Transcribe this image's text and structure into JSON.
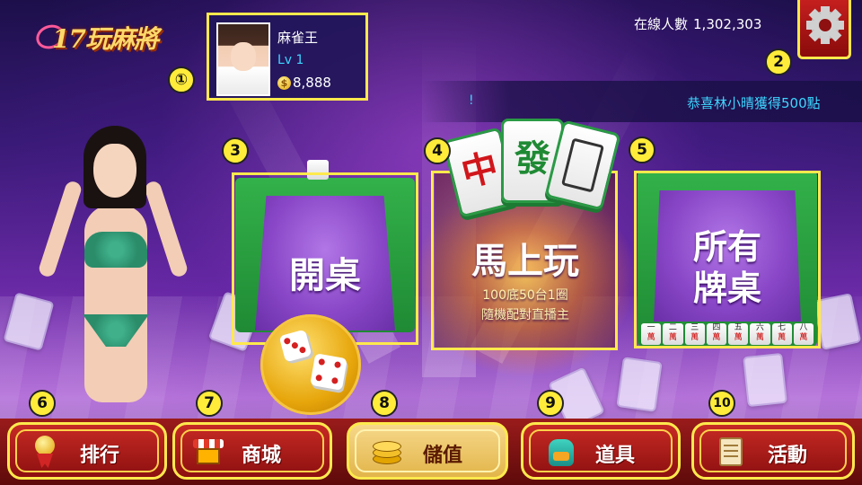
{
  "brand": {
    "logo_text": "17玩麻將"
  },
  "profile": {
    "name": "麻雀王",
    "level": "Lv 1",
    "coin_symbol": "$",
    "coins": "8,888"
  },
  "online": {
    "label": "在線人數",
    "count": "1,302,303"
  },
  "ticker": {
    "left_mark": "!",
    "text": "恭喜林小晴獲得500點"
  },
  "markers": [
    "①",
    "2",
    "3",
    "4",
    "5",
    "6",
    "7",
    "8",
    "9",
    "10"
  ],
  "tables": {
    "open": {
      "label": "開桌"
    },
    "quick": {
      "label": "馬上玩",
      "line1": "100底50台1圈",
      "line2": "隨機配對直播主",
      "tile_red": "中",
      "tile_green": "發"
    },
    "all": {
      "line1": "所有",
      "line2": "牌桌",
      "tiles": [
        "一",
        "二",
        "三",
        "四",
        "五",
        "六",
        "七",
        "八"
      ],
      "tile_suffix": "萬"
    }
  },
  "nav": [
    {
      "label": "排行",
      "icon": "medal-icon"
    },
    {
      "label": "商城",
      "icon": "store-icon"
    },
    {
      "label": "儲值",
      "icon": "coins-icon"
    },
    {
      "label": "道具",
      "icon": "backpack-icon"
    },
    {
      "label": "活動",
      "icon": "scroll-icon"
    }
  ],
  "colors": {
    "accent_yellow": "#ffe94d",
    "cyan": "#3dd6ff",
    "nav_red": "#c72a24",
    "felt_purple": "#8a48c8",
    "table_green": "#2a9a45"
  }
}
